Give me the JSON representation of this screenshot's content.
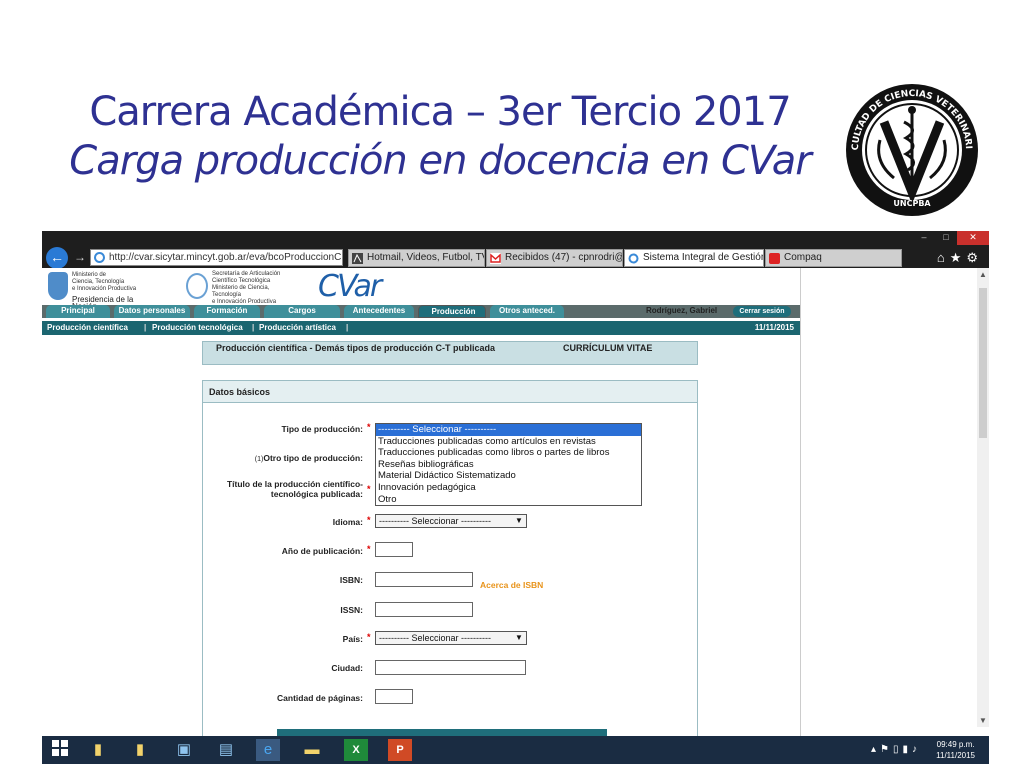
{
  "slide": {
    "title_line1": "Carrera Académica – 3er Tercio 2017",
    "title_line2": "Carga producción en docencia en CVar",
    "logo": {
      "ring_text": "FACULTAD DE CIENCIAS VETERINARIAS",
      "bottom_text": "UNCPBA"
    }
  },
  "browser": {
    "address": "http://cvar.sicytar.mincyt.gob.ar/eva/bcoProduccionC",
    "tabs": [
      {
        "label": "Hotmail, Videos, Futbol, TV, A...",
        "active": false
      },
      {
        "label": "Recibidos (47) - cpnrodri@gm...",
        "active": false
      },
      {
        "label": "Sistema Integral de Gestión ...",
        "active": true
      },
      {
        "label": "Compaq",
        "active": false
      }
    ]
  },
  "site": {
    "gov1_lines": [
      "Ministerio de",
      "Ciencia, Tecnología",
      "e Innovación Productiva"
    ],
    "gov1_pres": "Presidencia de la Nación",
    "gov2_lines": [
      "Secretaría de Articulación",
      "Científico Tecnológica",
      "Ministerio de Ciencia, Tecnología",
      "e Innovación Productiva"
    ],
    "brand": "CVar",
    "menu": [
      "Principal",
      "Datos personales",
      "Formación",
      "Cargos",
      "Antecedentes",
      "Producción",
      "Otros anteced."
    ],
    "menu_selected": "Producción",
    "user": "Rodríguez, Gabriel",
    "logout": "Cerrar sesión",
    "submenu": [
      "Producción científica",
      "Producción tecnológica",
      "Producción artística"
    ],
    "date": "11/11/2015"
  },
  "form": {
    "header_title": "Producción científica - Demás tipos de producción C-T publicada",
    "header_right": "CURRÍCULUM VITAE",
    "section": "Datos básicos",
    "labels": {
      "tipo": "Tipo de producción:",
      "otro_prefix": "(1)",
      "otro": "Otro tipo de producción:",
      "titulo": "Título de la producción científico-tecnológica publicada:",
      "idioma": "Idioma:",
      "anio": "Año de publicación:",
      "isbn": "ISBN:",
      "issn": "ISSN:",
      "pais": "País:",
      "ciudad": "Ciudad:",
      "paginas": "Cantidad de páginas:"
    },
    "required_mark": "*",
    "tipo_options": [
      "---------- Seleccionar ----------",
      "Traducciones publicadas como artículos en revistas",
      "Traducciones publicadas como libros o partes de libros",
      "Reseñas bibliográficas",
      "Material Didáctico Sistematizado",
      "Innovación pedagógica",
      "Otro"
    ],
    "idioma_selected": "---------- Seleccionar ----------",
    "pais_selected": "---------- Seleccionar ----------",
    "isbn_link": "Acerca de ISBN"
  },
  "taskbar": {
    "time": "09:49 p.m.",
    "date": "11/11/2015"
  }
}
